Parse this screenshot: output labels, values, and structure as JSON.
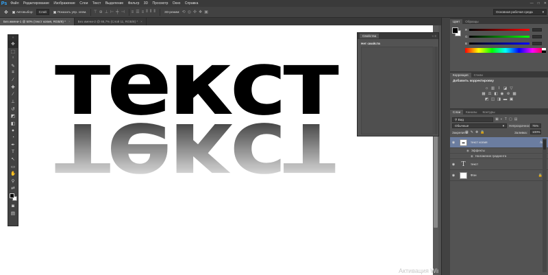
{
  "app": {
    "logo": "Ps"
  },
  "menu": [
    "Файл",
    "Редактирование",
    "Изображение",
    "Слои",
    "Текст",
    "Выделение",
    "Фильтр",
    "3D",
    "Просмотр",
    "Окно",
    "Справка"
  ],
  "window_controls": {
    "minimize": "—",
    "maximize": "□",
    "close": "✕"
  },
  "options": {
    "autoselect_label": "Автовыбор:",
    "autoselect_value": "Слой",
    "show_controls_label": "Показать упр. элем.",
    "mode_3d_label": "3D-режим:",
    "workspace": "Основная рабочая среда"
  },
  "tabs": [
    {
      "label": "Без имени-1 @ 50% (текст копия, RGB/8) *",
      "close": "×"
    },
    {
      "label": "Без имени-2 @ 66,7% (Слой 11, RGB/8) *",
      "close": "×"
    }
  ],
  "canvas": {
    "text": "текст",
    "watermark": "Активация Windows"
  },
  "properties": {
    "tab": "Свойства",
    "controls": "«  ≡",
    "no_props": "Нет свойств"
  },
  "color_panel": {
    "tabs": [
      "Цвет",
      "Образцы"
    ],
    "channels": [
      {
        "label": "R",
        "gradient": "linear-gradient(to right,#000,#ff0000)"
      },
      {
        "label": "G",
        "gradient": "linear-gradient(to right,#000,#00ff00)"
      },
      {
        "label": "B",
        "gradient": "linear-gradient(to right,#000,#0000ff)"
      }
    ]
  },
  "adjustments": {
    "tabs": [
      "Коррекция",
      "Стили"
    ],
    "title": "Добавить корректировку"
  },
  "layers": {
    "tabs": [
      "Слои",
      "Каналы",
      "Контуры"
    ],
    "filter": "Вид",
    "blend_mode": "Обычные",
    "opacity_label": "Непрозрачность:",
    "opacity": "75%",
    "lock_label": "Закрепить:",
    "fill_label": "Заливка:",
    "fill": "100%",
    "items": [
      {
        "name": "текст копия",
        "fx": "fx",
        "selected": true
      },
      {
        "name": "текст"
      },
      {
        "name": "Фон"
      }
    ],
    "effects_label": "Эффекты",
    "gradient_overlay": "Наложение градиента"
  }
}
